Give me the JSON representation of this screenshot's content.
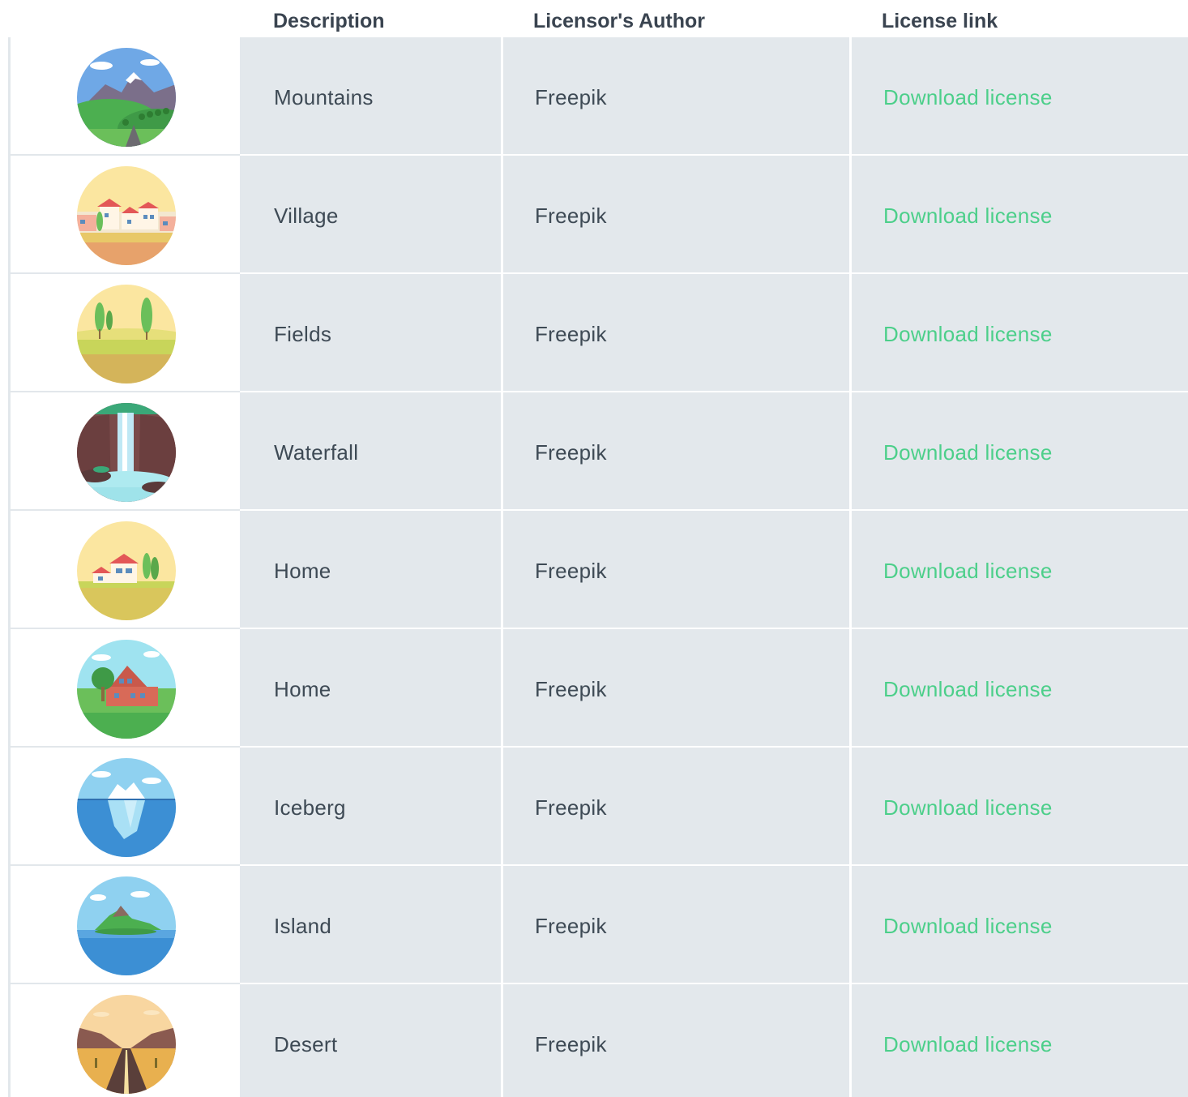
{
  "header": {
    "description": "Description",
    "author": "Licensor's Author",
    "license": "License link"
  },
  "rows": [
    {
      "icon": "mountains-icon",
      "description": "Mountains",
      "author": "Freepik",
      "link": "Download license"
    },
    {
      "icon": "village-icon",
      "description": "Village",
      "author": "Freepik",
      "link": "Download license"
    },
    {
      "icon": "fields-icon",
      "description": "Fields",
      "author": "Freepik",
      "link": "Download license"
    },
    {
      "icon": "waterfall-icon",
      "description": "Waterfall",
      "author": "Freepik",
      "link": "Download license"
    },
    {
      "icon": "home-fields-icon",
      "description": "Home",
      "author": "Freepik",
      "link": "Download license"
    },
    {
      "icon": "home-green-icon",
      "description": "Home",
      "author": "Freepik",
      "link": "Download license"
    },
    {
      "icon": "iceberg-icon",
      "description": "Iceberg",
      "author": "Freepik",
      "link": "Download license"
    },
    {
      "icon": "island-icon",
      "description": "Island",
      "author": "Freepik",
      "link": "Download license"
    },
    {
      "icon": "desert-icon",
      "description": "Desert",
      "author": "Freepik",
      "link": "Download license"
    }
  ],
  "colors": {
    "header_text": "#3a4450",
    "cell_bg": "#e3e8ec",
    "cell_text": "#3e4a55",
    "link": "#4ccf8a"
  }
}
